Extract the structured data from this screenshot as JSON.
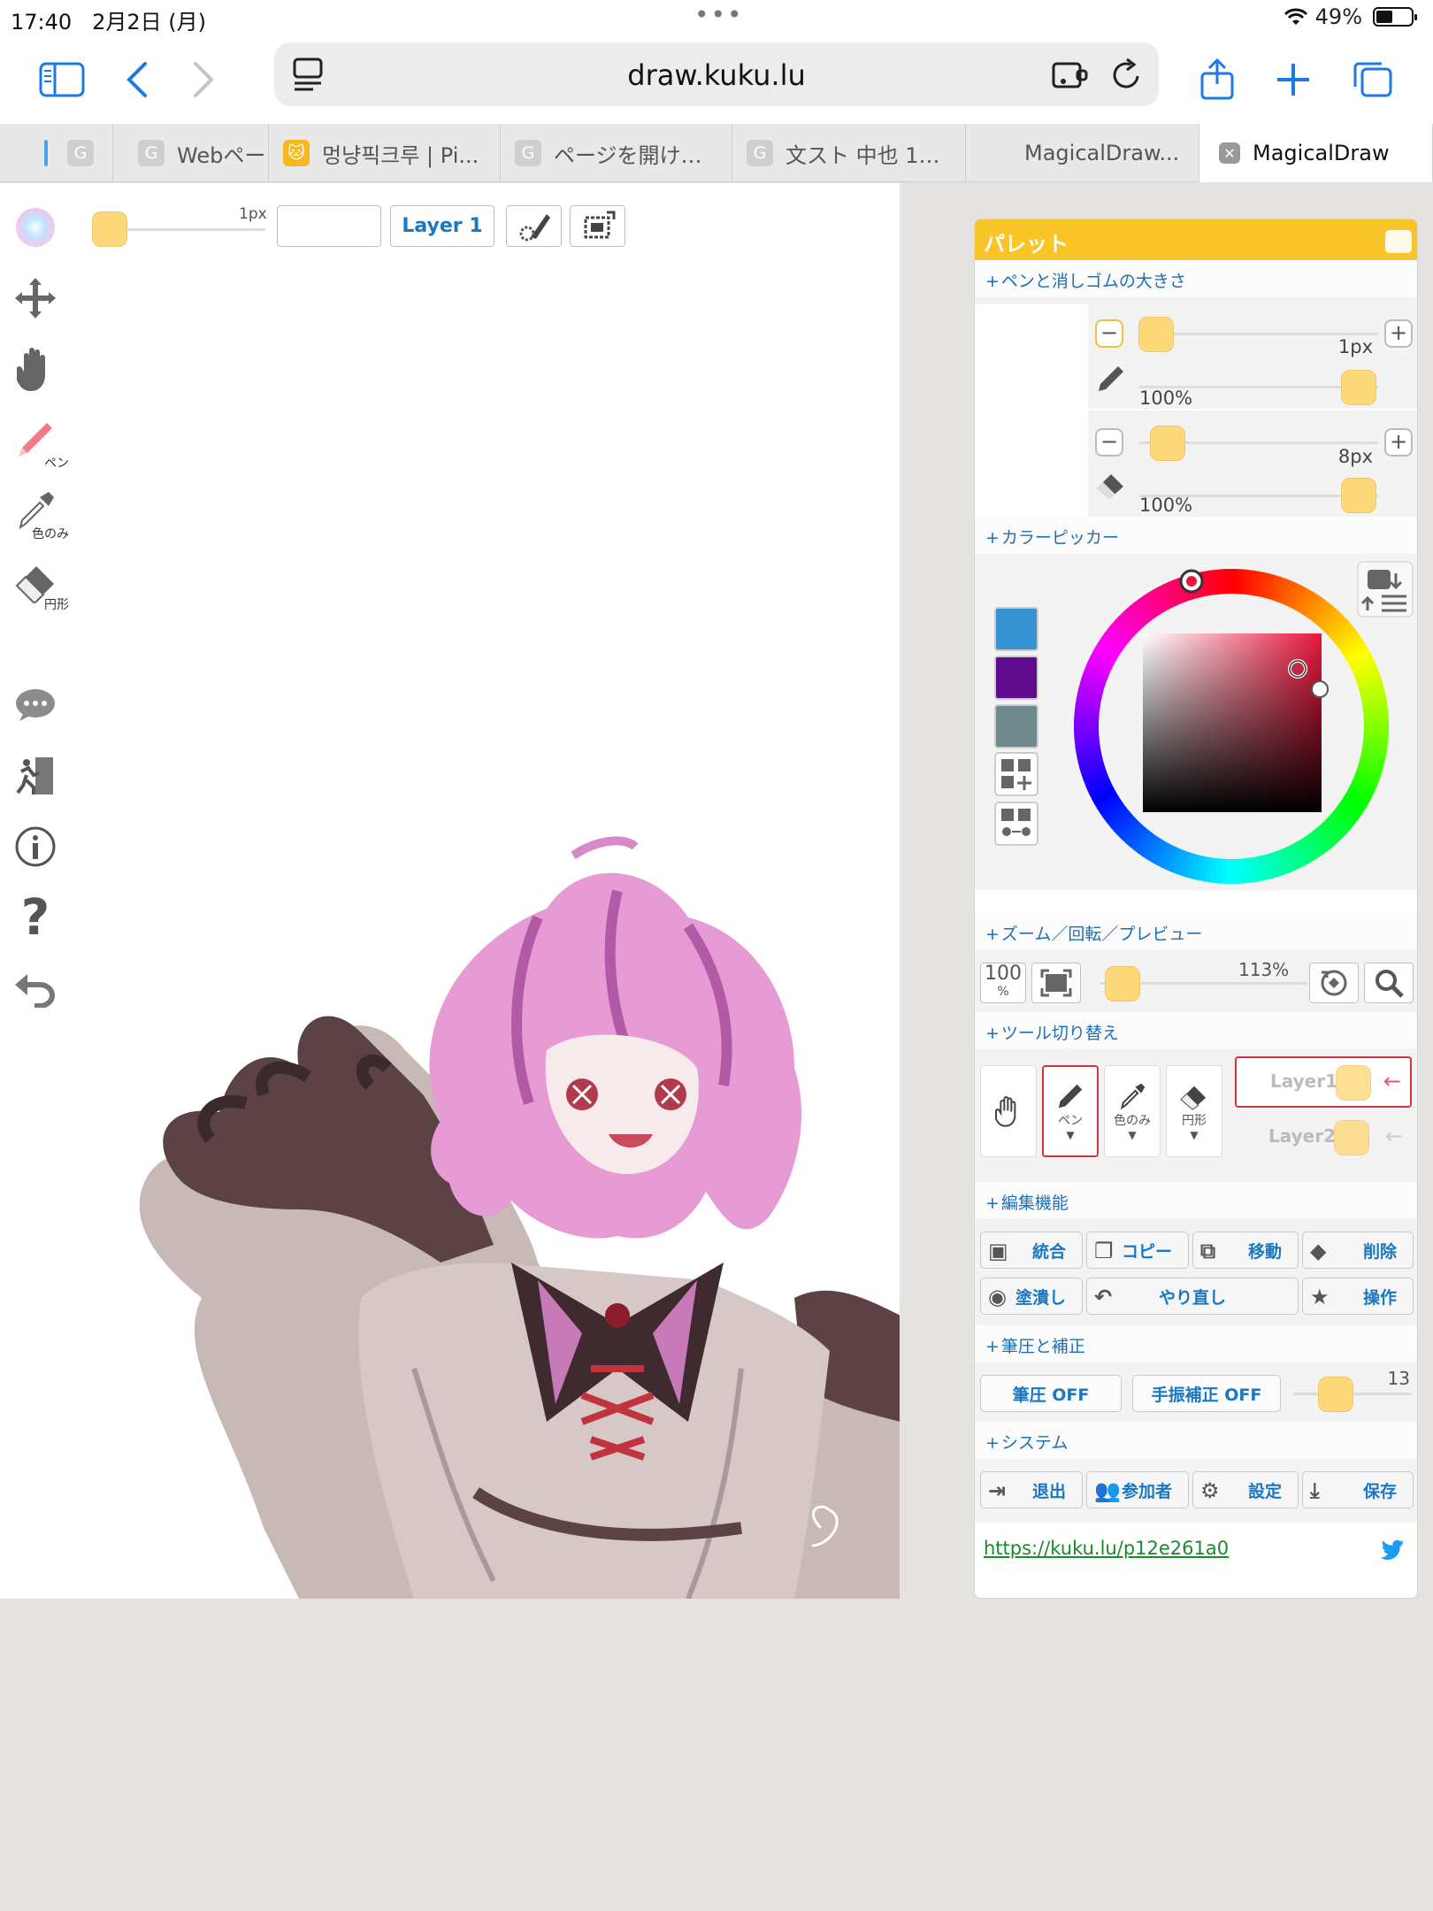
{
  "status": {
    "time": "17:40",
    "date": "2月2日 (月)",
    "dots": "•••",
    "battery": "49%"
  },
  "browser": {
    "url": "draw.kuku.lu",
    "tabs": [
      {
        "label": "",
        "fav": "G"
      },
      {
        "label": "Webペー",
        "fav": "G"
      },
      {
        "label": "멍냥픽크루 | Pi...",
        "fav": "🐱"
      },
      {
        "label": "ページを開け…",
        "fav": "G"
      },
      {
        "label": "文スト 中也 1…",
        "fav": "G"
      },
      {
        "label": "MagicalDraw...",
        "fav": ""
      },
      {
        "label": "MagicalDraw",
        "fav": "✕"
      }
    ]
  },
  "canvas_top": {
    "size_label": "1px",
    "layer_label": "Layer 1"
  },
  "left_tools": {
    "pen": "ペン",
    "picker": "色のみ",
    "shape": "円形"
  },
  "palette": {
    "title": "パレット",
    "sections": {
      "pen_size": "ペンと消しゴムの大きさ",
      "color_picker": "カラーピッカー",
      "zoom": "ズーム／回転／プレビュー",
      "tool_switch": "ツール切り替え",
      "edit": "編集機能",
      "pressure": "筆圧と補正",
      "system": "システム"
    },
    "pen": {
      "size": "1px",
      "opacity": "100%"
    },
    "eraser": {
      "size": "8px",
      "opacity": "100%"
    },
    "swatches": [
      "#3593d1",
      "#5e0c8c",
      "#6f8a8c"
    ],
    "zoom": {
      "reset": "100",
      "reset_sub": "%",
      "value": "113%"
    },
    "tools": {
      "pen": "ペン",
      "picker": "色のみ",
      "shape": "円形"
    },
    "layers": [
      "Layer1",
      "Layer2"
    ],
    "edit_buttons": [
      "統合",
      "コピー",
      "移動",
      "削除",
      "塗潰し",
      "やり直し",
      "操作"
    ],
    "pressure": {
      "pressure_btn": "筆圧 OFF",
      "stabilizer_btn": "手振補正 OFF",
      "value": "13"
    },
    "system_buttons": [
      "退出",
      "参加者",
      "設定",
      "保存"
    ],
    "link": "https://kuku.lu/p12e261a0"
  }
}
